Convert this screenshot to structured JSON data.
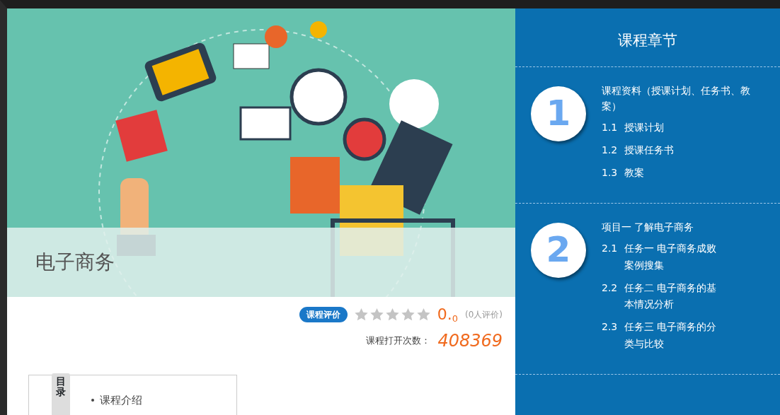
{
  "banner": {
    "title": "电子商务"
  },
  "rating": {
    "badge": "课程评价",
    "stars": 0,
    "score": "0.$_{0}$",
    "count": "(0人评价)"
  },
  "views": {
    "label": "课程打开次数：",
    "value": "408369"
  },
  "toc": {
    "tab": "目录",
    "items": [
      "课程介绍"
    ]
  },
  "sidebar": {
    "title": "课程章节",
    "chapters": [
      {
        "number": "1",
        "title": "课程资料（授课计划、任务书、教案）",
        "items": [
          {
            "number": "1.1",
            "title": "授课计划"
          },
          {
            "number": "1.2",
            "title": "授课任务书"
          },
          {
            "number": "1.3",
            "title": "教案"
          }
        ]
      },
      {
        "number": "2",
        "title": "项目一 了解电子商务",
        "items": [
          {
            "number": "2.1",
            "title": "任务一 电子商务成败案例搜集"
          },
          {
            "number": "2.2",
            "title": "任务二 电子商务的基本情况分析"
          },
          {
            "number": "2.3",
            "title": "任务三 电子商务的分类与比较"
          }
        ]
      }
    ]
  }
}
